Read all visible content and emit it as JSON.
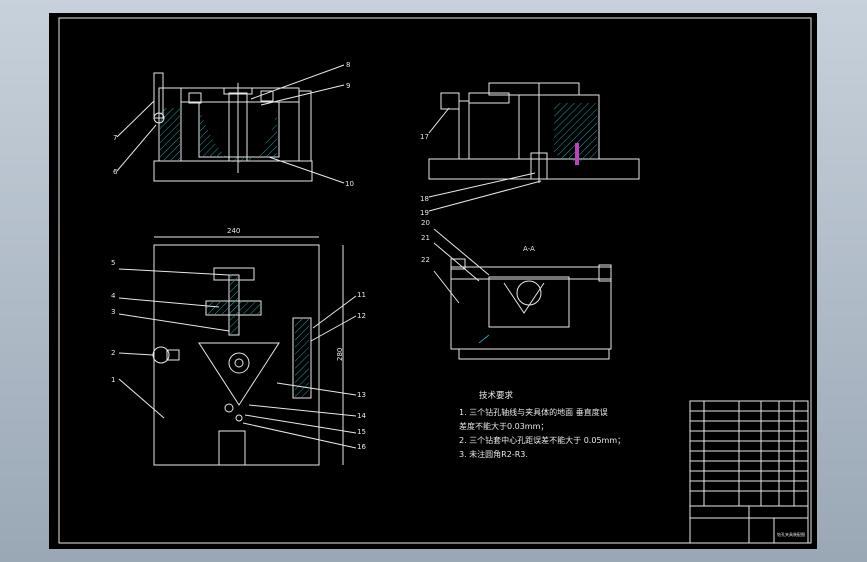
{
  "callouts_top_left": [
    "8",
    "9",
    "7",
    "6",
    "10"
  ],
  "callouts_top_right": [
    "17",
    "18",
    "19"
  ],
  "callouts_bottom_right": [
    "20",
    "21",
    "22"
  ],
  "callouts_plan_left": [
    "5",
    "4",
    "3",
    "2",
    "1"
  ],
  "callouts_plan_right": [
    "11",
    "12",
    "13",
    "14",
    "15",
    "16"
  ],
  "dim_width": "240",
  "dim_height": "280",
  "section_label": "A-A",
  "tech_title": "技术要求",
  "tech_lines": [
    "1. 三个钻孔轴线与夹具体的地面 垂直度误",
    "差度不能大于0.03mm；",
    "2. 三个钻套中心孔距误差不能大于   0.05mm；",
    "3. 未注圆角R2-R3."
  ],
  "title_block_name": "钻孔夹具装配图",
  "colors": {
    "outline": "#e8e8e8",
    "accent": "#e6e600",
    "section": "#1aa3a3",
    "sheet": "#000000"
  }
}
